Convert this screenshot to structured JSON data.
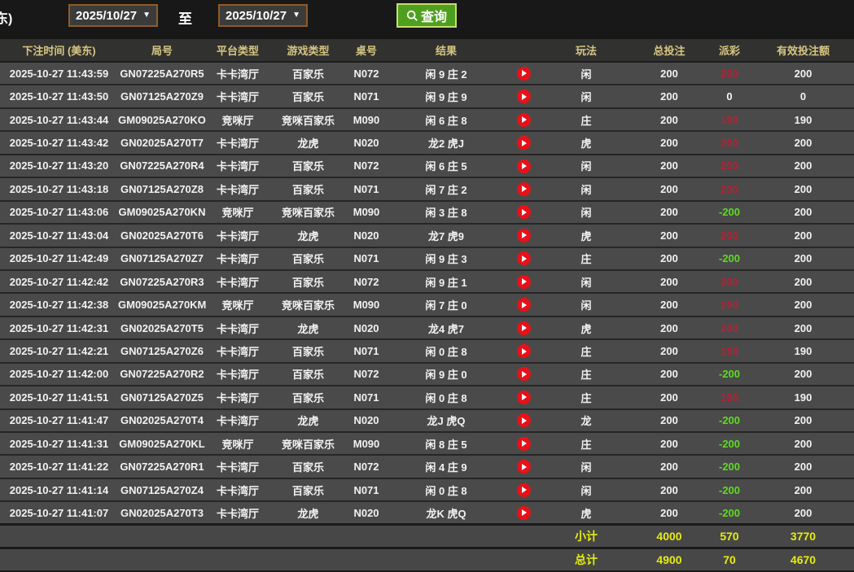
{
  "toolbar": {
    "clipped_label": "东)",
    "date_from": "2025/10/27",
    "date_to": "2025/10/27",
    "dropdown_arrow": "▼",
    "to_label": "至",
    "query_label": "查询"
  },
  "colors": {
    "payout_win_red": "#b52134",
    "payout_loss_green": "#5cdc20",
    "payout_zero_white": "#f5f5f5",
    "totals_yellow": "#e6ed0a",
    "header_text_khaki": "#d7c682",
    "row_bg": "#4a4a4a",
    "header_bg": "#313130",
    "query_button_green": "#4f9f1f",
    "date_border_brown": "#8f5c24",
    "play_icon_red": "#e81118"
  },
  "table": {
    "headers": [
      "下注时间 (美东)",
      "局号",
      "平台类型",
      "游戏类型",
      "桌号",
      "结果",
      "",
      "玩法",
      "总投注",
      "派彩",
      "有效投注额"
    ],
    "rows": [
      {
        "time": "2025-10-27 11:43:59",
        "round": "GN07225A270R5",
        "platform": "卡卡湾厅",
        "game": "百家乐",
        "table_no": "N072",
        "result": "闲 9 庄 2",
        "play": "闲",
        "total_bet": "200",
        "payout": "200",
        "valid_bet": "200",
        "payout_state": "win"
      },
      {
        "time": "2025-10-27 11:43:50",
        "round": "GN07125A270Z9",
        "platform": "卡卡湾厅",
        "game": "百家乐",
        "table_no": "N071",
        "result": "闲 9 庄 9",
        "play": "闲",
        "total_bet": "200",
        "payout": "0",
        "valid_bet": "0",
        "payout_state": "zero"
      },
      {
        "time": "2025-10-27 11:43:44",
        "round": "GM09025A270KO",
        "platform": "竞咪厅",
        "game": "竞咪百家乐",
        "table_no": "M090",
        "result": "闲 6 庄 8",
        "play": "庄",
        "total_bet": "200",
        "payout": "190",
        "valid_bet": "190",
        "payout_state": "win"
      },
      {
        "time": "2025-10-27 11:43:42",
        "round": "GN02025A270T7",
        "platform": "卡卡湾厅",
        "game": "龙虎",
        "table_no": "N020",
        "result": "龙2 虎J",
        "play": "虎",
        "total_bet": "200",
        "payout": "200",
        "valid_bet": "200",
        "payout_state": "win"
      },
      {
        "time": "2025-10-27 11:43:20",
        "round": "GN07225A270R4",
        "platform": "卡卡湾厅",
        "game": "百家乐",
        "table_no": "N072",
        "result": "闲 6 庄 5",
        "play": "闲",
        "total_bet": "200",
        "payout": "200",
        "valid_bet": "200",
        "payout_state": "win"
      },
      {
        "time": "2025-10-27 11:43:18",
        "round": "GN07125A270Z8",
        "platform": "卡卡湾厅",
        "game": "百家乐",
        "table_no": "N071",
        "result": "闲 7 庄 2",
        "play": "闲",
        "total_bet": "200",
        "payout": "200",
        "valid_bet": "200",
        "payout_state": "win"
      },
      {
        "time": "2025-10-27 11:43:06",
        "round": "GM09025A270KN",
        "platform": "竞咪厅",
        "game": "竞咪百家乐",
        "table_no": "M090",
        "result": "闲 3 庄 8",
        "play": "闲",
        "total_bet": "200",
        "payout": "-200",
        "valid_bet": "200",
        "payout_state": "loss"
      },
      {
        "time": "2025-10-27 11:43:04",
        "round": "GN02025A270T6",
        "platform": "卡卡湾厅",
        "game": "龙虎",
        "table_no": "N020",
        "result": "龙7 虎9",
        "play": "虎",
        "total_bet": "200",
        "payout": "200",
        "valid_bet": "200",
        "payout_state": "win"
      },
      {
        "time": "2025-10-27 11:42:49",
        "round": "GN07125A270Z7",
        "platform": "卡卡湾厅",
        "game": "百家乐",
        "table_no": "N071",
        "result": "闲 9 庄 3",
        "play": "庄",
        "total_bet": "200",
        "payout": "-200",
        "valid_bet": "200",
        "payout_state": "loss"
      },
      {
        "time": "2025-10-27 11:42:42",
        "round": "GN07225A270R3",
        "platform": "卡卡湾厅",
        "game": "百家乐",
        "table_no": "N072",
        "result": "闲 9 庄 1",
        "play": "闲",
        "total_bet": "200",
        "payout": "200",
        "valid_bet": "200",
        "payout_state": "win"
      },
      {
        "time": "2025-10-27 11:42:38",
        "round": "GM09025A270KM",
        "platform": "竞咪厅",
        "game": "竞咪百家乐",
        "table_no": "M090",
        "result": "闲 7 庄 0",
        "play": "闲",
        "total_bet": "200",
        "payout": "200",
        "valid_bet": "200",
        "payout_state": "win"
      },
      {
        "time": "2025-10-27 11:42:31",
        "round": "GN02025A270T5",
        "platform": "卡卡湾厅",
        "game": "龙虎",
        "table_no": "N020",
        "result": "龙4 虎7",
        "play": "虎",
        "total_bet": "200",
        "payout": "200",
        "valid_bet": "200",
        "payout_state": "win"
      },
      {
        "time": "2025-10-27 11:42:21",
        "round": "GN07125A270Z6",
        "platform": "卡卡湾厅",
        "game": "百家乐",
        "table_no": "N071",
        "result": "闲 0 庄 8",
        "play": "庄",
        "total_bet": "200",
        "payout": "190",
        "valid_bet": "190",
        "payout_state": "win"
      },
      {
        "time": "2025-10-27 11:42:00",
        "round": "GN07225A270R2",
        "platform": "卡卡湾厅",
        "game": "百家乐",
        "table_no": "N072",
        "result": "闲 9 庄 0",
        "play": "庄",
        "total_bet": "200",
        "payout": "-200",
        "valid_bet": "200",
        "payout_state": "loss"
      },
      {
        "time": "2025-10-27 11:41:51",
        "round": "GN07125A270Z5",
        "platform": "卡卡湾厅",
        "game": "百家乐",
        "table_no": "N071",
        "result": "闲 0 庄 8",
        "play": "庄",
        "total_bet": "200",
        "payout": "190",
        "valid_bet": "190",
        "payout_state": "win"
      },
      {
        "time": "2025-10-27 11:41:47",
        "round": "GN02025A270T4",
        "platform": "卡卡湾厅",
        "game": "龙虎",
        "table_no": "N020",
        "result": "龙J 虎Q",
        "play": "龙",
        "total_bet": "200",
        "payout": "-200",
        "valid_bet": "200",
        "payout_state": "loss"
      },
      {
        "time": "2025-10-27 11:41:31",
        "round": "GM09025A270KL",
        "platform": "竞咪厅",
        "game": "竞咪百家乐",
        "table_no": "M090",
        "result": "闲 8 庄 5",
        "play": "庄",
        "total_bet": "200",
        "payout": "-200",
        "valid_bet": "200",
        "payout_state": "loss"
      },
      {
        "time": "2025-10-27 11:41:22",
        "round": "GN07225A270R1",
        "platform": "卡卡湾厅",
        "game": "百家乐",
        "table_no": "N072",
        "result": "闲 4 庄 9",
        "play": "闲",
        "total_bet": "200",
        "payout": "-200",
        "valid_bet": "200",
        "payout_state": "loss"
      },
      {
        "time": "2025-10-27 11:41:14",
        "round": "GN07125A270Z4",
        "platform": "卡卡湾厅",
        "game": "百家乐",
        "table_no": "N071",
        "result": "闲 0 庄 8",
        "play": "闲",
        "total_bet": "200",
        "payout": "-200",
        "valid_bet": "200",
        "payout_state": "loss"
      },
      {
        "time": "2025-10-27 11:41:07",
        "round": "GN02025A270T3",
        "platform": "卡卡湾厅",
        "game": "龙虎",
        "table_no": "N020",
        "result": "龙K 虎Q",
        "play": "虎",
        "total_bet": "200",
        "payout": "-200",
        "valid_bet": "200",
        "payout_state": "loss"
      }
    ],
    "subtotal": {
      "label": "小计",
      "total_bet": "4000",
      "payout": "570",
      "valid_bet": "3770"
    },
    "total": {
      "label": "总计",
      "total_bet": "4900",
      "payout": "70",
      "valid_bet": "4670"
    }
  }
}
